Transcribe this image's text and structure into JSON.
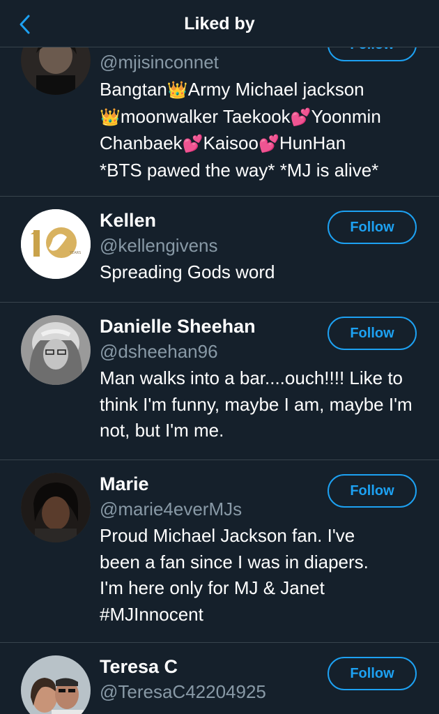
{
  "header": {
    "title": "Liked by",
    "back_icon": "chevron-left-icon"
  },
  "colors": {
    "background": "#15202b",
    "accent": "#1da1f2",
    "secondary_text": "#8899a6",
    "divider": "#38444d"
  },
  "users": [
    {
      "name": "",
      "handle": "@mjisinconnet",
      "follow_label": "Follow",
      "bio": {
        "line1_a": "Bangtan",
        "line1_emoji": "👑",
        "line1_b": "Army Michael jackson",
        "line2_emoji": "👑",
        "line2_b": "moonwalker Taekook",
        "line2_emoji2": "💕",
        "line2_c": "Yoonmin",
        "line3_a": "Chanbaek",
        "line3_emoji": "💕",
        "line3_b": "Kaisoo",
        "line3_emoji2": "💕",
        "line3_c": "HunHan",
        "line4": "*BTS pawed the way* *MJ is alive*"
      }
    },
    {
      "name": "Kellen",
      "handle": "@kellengivens",
      "follow_label": "Follow",
      "avatar_text": "YEARS",
      "bio": "Spreading Gods word"
    },
    {
      "name": "Danielle Sheehan",
      "handle": "@dsheehan96",
      "follow_label": "Follow",
      "bio": "Man walks into a bar....ouch!!!! Like to think I'm funny, maybe I am, maybe I'm not, but I'm me."
    },
    {
      "name": "Marie",
      "handle": "@marie4everMJs",
      "follow_label": "Follow",
      "bio": "Proud Michael Jackson fan. I've been a fan since I was in diapers. I'm here only for MJ & Janet #MJInnocent"
    },
    {
      "name": "Teresa C",
      "handle": "@TeresaC42204925",
      "follow_label": "Follow",
      "bio": ""
    }
  ]
}
